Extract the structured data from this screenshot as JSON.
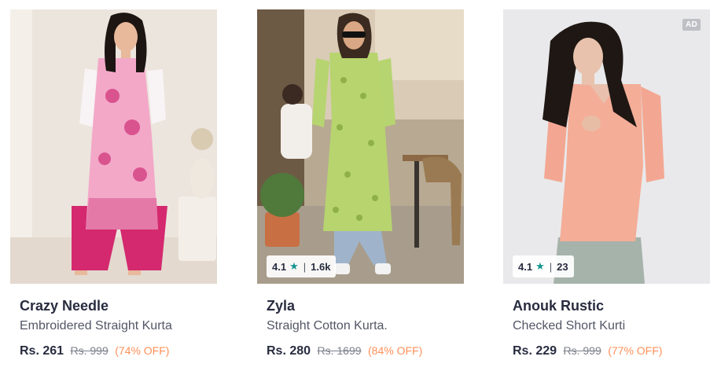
{
  "products": [
    {
      "brand": "Crazy Needle",
      "title": "Embroidered Straight Kurta",
      "price": "Rs. 261",
      "mrp": "Rs. 999",
      "discount": "(74% OFF)",
      "image_alt": "woman in pink floral kurta with pink palazzo"
    },
    {
      "brand": "Zyla",
      "title": "Straight Cotton Kurta.",
      "price": "Rs. 280",
      "mrp": "Rs. 1699",
      "discount": "(84% OFF)",
      "rating": "4.1",
      "rating_count": "1.6k",
      "image_alt": "woman in green printed kurta at street cafe"
    },
    {
      "brand": "Anouk Rustic",
      "title": "Checked Short Kurti",
      "price": "Rs. 229",
      "mrp": "Rs. 999",
      "discount": "(77% OFF)",
      "rating": "4.1",
      "rating_count": "23",
      "ad_label": "AD",
      "image_alt": "woman in peach short kurti"
    }
  ],
  "colors": {
    "star": "#14958f",
    "discount": "#ff905a",
    "brand_text": "#282c3f",
    "muted_text": "#535766"
  },
  "icons": {
    "rating": "star-icon"
  }
}
